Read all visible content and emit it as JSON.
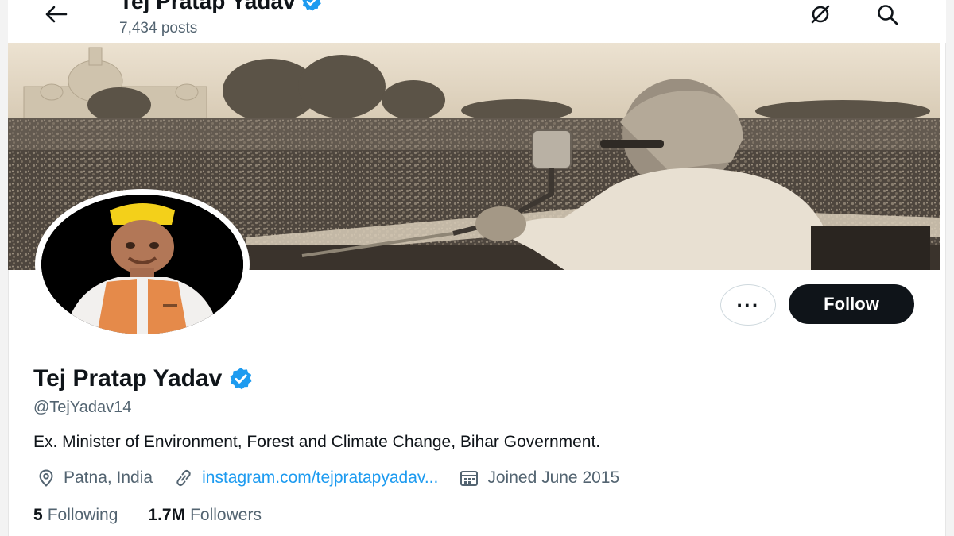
{
  "header": {
    "title": "Tej Pratap Yadav",
    "posts_count": "7,434 posts",
    "icons": [
      "back-arrow-icon",
      "search-off-icon",
      "search-icon"
    ]
  },
  "profile": {
    "name": "Tej Pratap Yadav",
    "handle": "@TejYadav14",
    "bio": "Ex. Minister of Environment, Forest and Climate Change, Bihar Government.",
    "location": "Patna, India",
    "website": "instagram.com/tejpratapyadav...",
    "joined": "Joined June 2015",
    "following_count": "5",
    "following_label": "Following",
    "followers_count": "1.7M",
    "followers_label": "Followers"
  },
  "actions": {
    "more_label": "···",
    "follow_label": "Follow"
  },
  "colors": {
    "accent": "#1d9bf0",
    "follow_button": "#0f1419",
    "secondary_text": "#536471"
  }
}
